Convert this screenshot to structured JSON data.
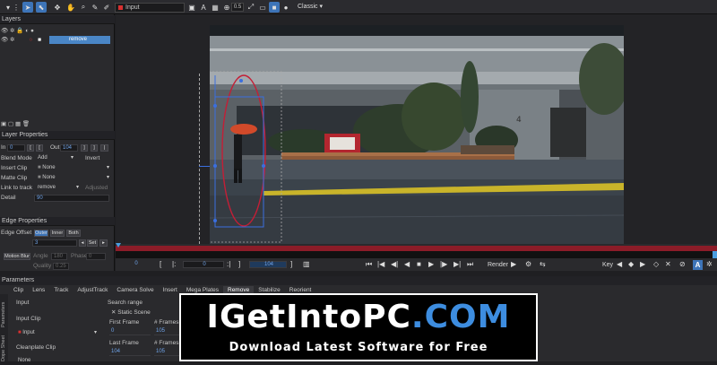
{
  "toolbar": {
    "input_label": "Input",
    "zoom_value": "0.5",
    "workspace": "Classic",
    "icons": [
      "pointer-tool",
      "select-tool",
      "transform-tool",
      "hand-tool",
      "zoom-tool",
      "crop-tool",
      "paint-tool",
      "color-picker",
      "frame-tool",
      "brush-tool",
      "redo-tool",
      "undo-tool"
    ]
  },
  "layers": {
    "title": "Layers",
    "items": [
      {
        "name": "remove"
      }
    ]
  },
  "layer_properties": {
    "title": "Layer Properties",
    "in_label": "In",
    "in_value": "0",
    "out_label": "Out",
    "out_value": "104",
    "blend_mode_label": "Blend Mode",
    "blend_mode_value": "Add",
    "invert_label": "Invert",
    "insert_clip_label": "Insert Clip",
    "insert_clip_value": "None",
    "matte_clip_label": "Matte Clip",
    "matte_clip_value": "None",
    "link_to_track_label": "Link to track",
    "link_to_track_value": "remove",
    "adjusted_label": "Adjusted",
    "detail_label": "Detail",
    "detail_value": "90"
  },
  "edge_properties": {
    "title": "Edge Properties",
    "edge_offset_label": "Edge Offset",
    "edge_modes": [
      "Outer",
      "Inner",
      "Both"
    ],
    "offset_value": "3",
    "set_label": "Set",
    "motion_blur_label": "Motion Blur",
    "angle_label": "Angle",
    "angle_value": "180",
    "phase_label": "Phase",
    "phase_value": "0",
    "quality_label": "Quality",
    "quality_value": "0.25"
  },
  "timeline": {
    "start_frame": "0",
    "in_frame": "0",
    "current_frame": "104",
    "render_label": "Render",
    "key_label": "Key",
    "mode_label": "A"
  },
  "parameters": {
    "title": "Parameters",
    "tabs": [
      "Clip",
      "Lens",
      "Track",
      "AdjustTrack",
      "Camera Solve",
      "Insert",
      "Mega Plates",
      "Remove",
      "Stabilize",
      "Reorient"
    ],
    "active_tab": "Remove",
    "side_tabs": [
      "Parameters",
      "Dope Sheet"
    ],
    "input_label": "Input",
    "input_clip_label": "Input Clip",
    "input_clip_value": "Input",
    "cleanplate_label": "Cleanplate Clip",
    "cleanplate_value": "None",
    "search_range_label": "Search range",
    "static_scene_label": "Static Scene",
    "first_frame_label": "First Frame",
    "first_frame_value": "0",
    "last_frame_label": "Last Frame",
    "last_frame_value": "104",
    "frames_label": "# Frames",
    "frames_value_1": "105",
    "frames_value_2": "105"
  },
  "watermark": {
    "brand_main": "IGetIntoPC",
    "brand_sep": ".",
    "brand_tld": "com",
    "tagline": "Download Latest Software for Free"
  },
  "colors": {
    "accent_blue": "#3d74b8",
    "track_red": "#8c1c28",
    "layer_highlight": "#4a86c6"
  }
}
